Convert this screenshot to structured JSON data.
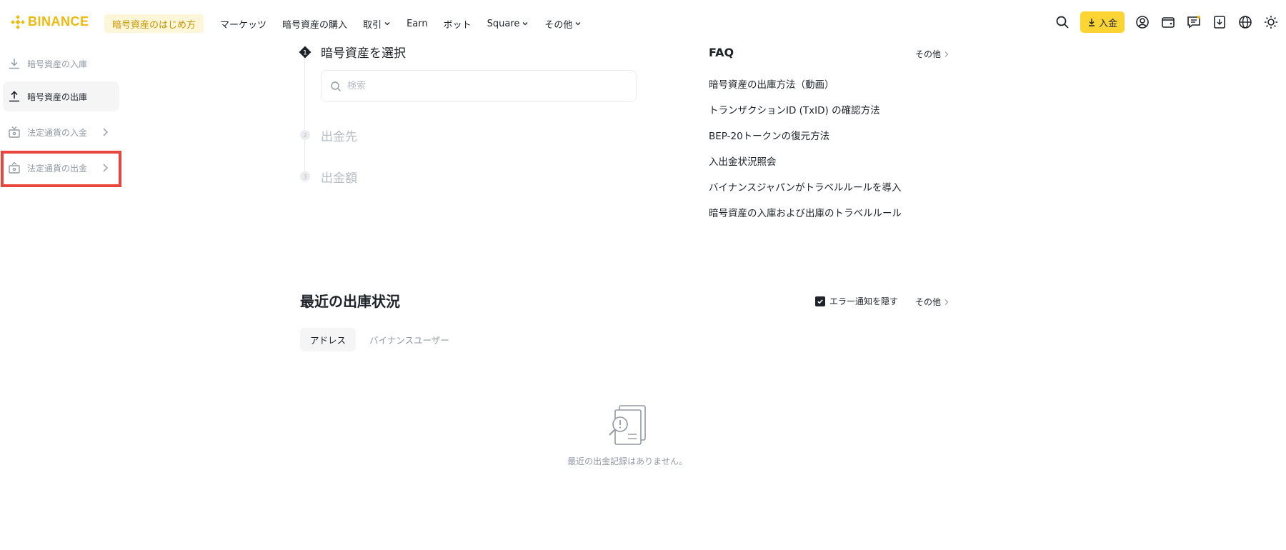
{
  "header": {
    "logo_text": "BINANCE",
    "nav": [
      {
        "label": "暗号資産のはじめ方",
        "highlight": true
      },
      {
        "label": "マーケッツ"
      },
      {
        "label": "暗号資産の購入"
      },
      {
        "label": "取引",
        "dropdown": true
      },
      {
        "label": "Earn"
      },
      {
        "label": "ボット"
      },
      {
        "label": "Square",
        "dropdown": true
      },
      {
        "label": "その他",
        "dropdown": true
      }
    ],
    "deposit_label": "入金",
    "icons": [
      "search-icon",
      "download-arrow-icon",
      "user-circle-icon",
      "wallet-icon",
      "messages-icon",
      "download-app-icon",
      "globe-icon",
      "sun-icon"
    ],
    "accent": "#fcd535",
    "brand": "#f0b90b"
  },
  "sidebar": {
    "items": [
      {
        "label": "暗号資産の入庫",
        "icon": "download-icon",
        "active": false
      },
      {
        "label": "暗号資産の出庫",
        "icon": "upload-icon",
        "active": true
      },
      {
        "label": "法定通貨の入金",
        "icon": "fiat-deposit-icon",
        "active": false,
        "chevron": true
      },
      {
        "label": "法定通貨の出金",
        "icon": "fiat-withdraw-icon",
        "active": false,
        "chevron": true
      }
    ],
    "highlight_color": "#e8453c"
  },
  "steps": {
    "step1": {
      "number": "1",
      "title": "暗号資産を選択"
    },
    "search_placeholder": "検索",
    "step2": {
      "number": "2",
      "title": "出金先"
    },
    "step3": {
      "number": "3",
      "title": "出金額"
    }
  },
  "faq": {
    "title": "FAQ",
    "more": "その他",
    "items": [
      "暗号資産の出庫方法（動画）",
      "トランザクションID (TxID) の確認方法",
      "BEP-20トークンの復元方法",
      "入出金状況照会",
      "バイナンスジャパンがトラベルルールを導入",
      "暗号資産の入庫および出庫のトラベルルール"
    ]
  },
  "recent": {
    "title": "最近の出庫状況",
    "error_toggle_label": "エラー通知を隠す",
    "error_toggle_checked": true,
    "more": "その他",
    "tabs": [
      "アドレス",
      "バイナンスユーザー"
    ],
    "empty_text": "最近の出金記録はありません。"
  }
}
